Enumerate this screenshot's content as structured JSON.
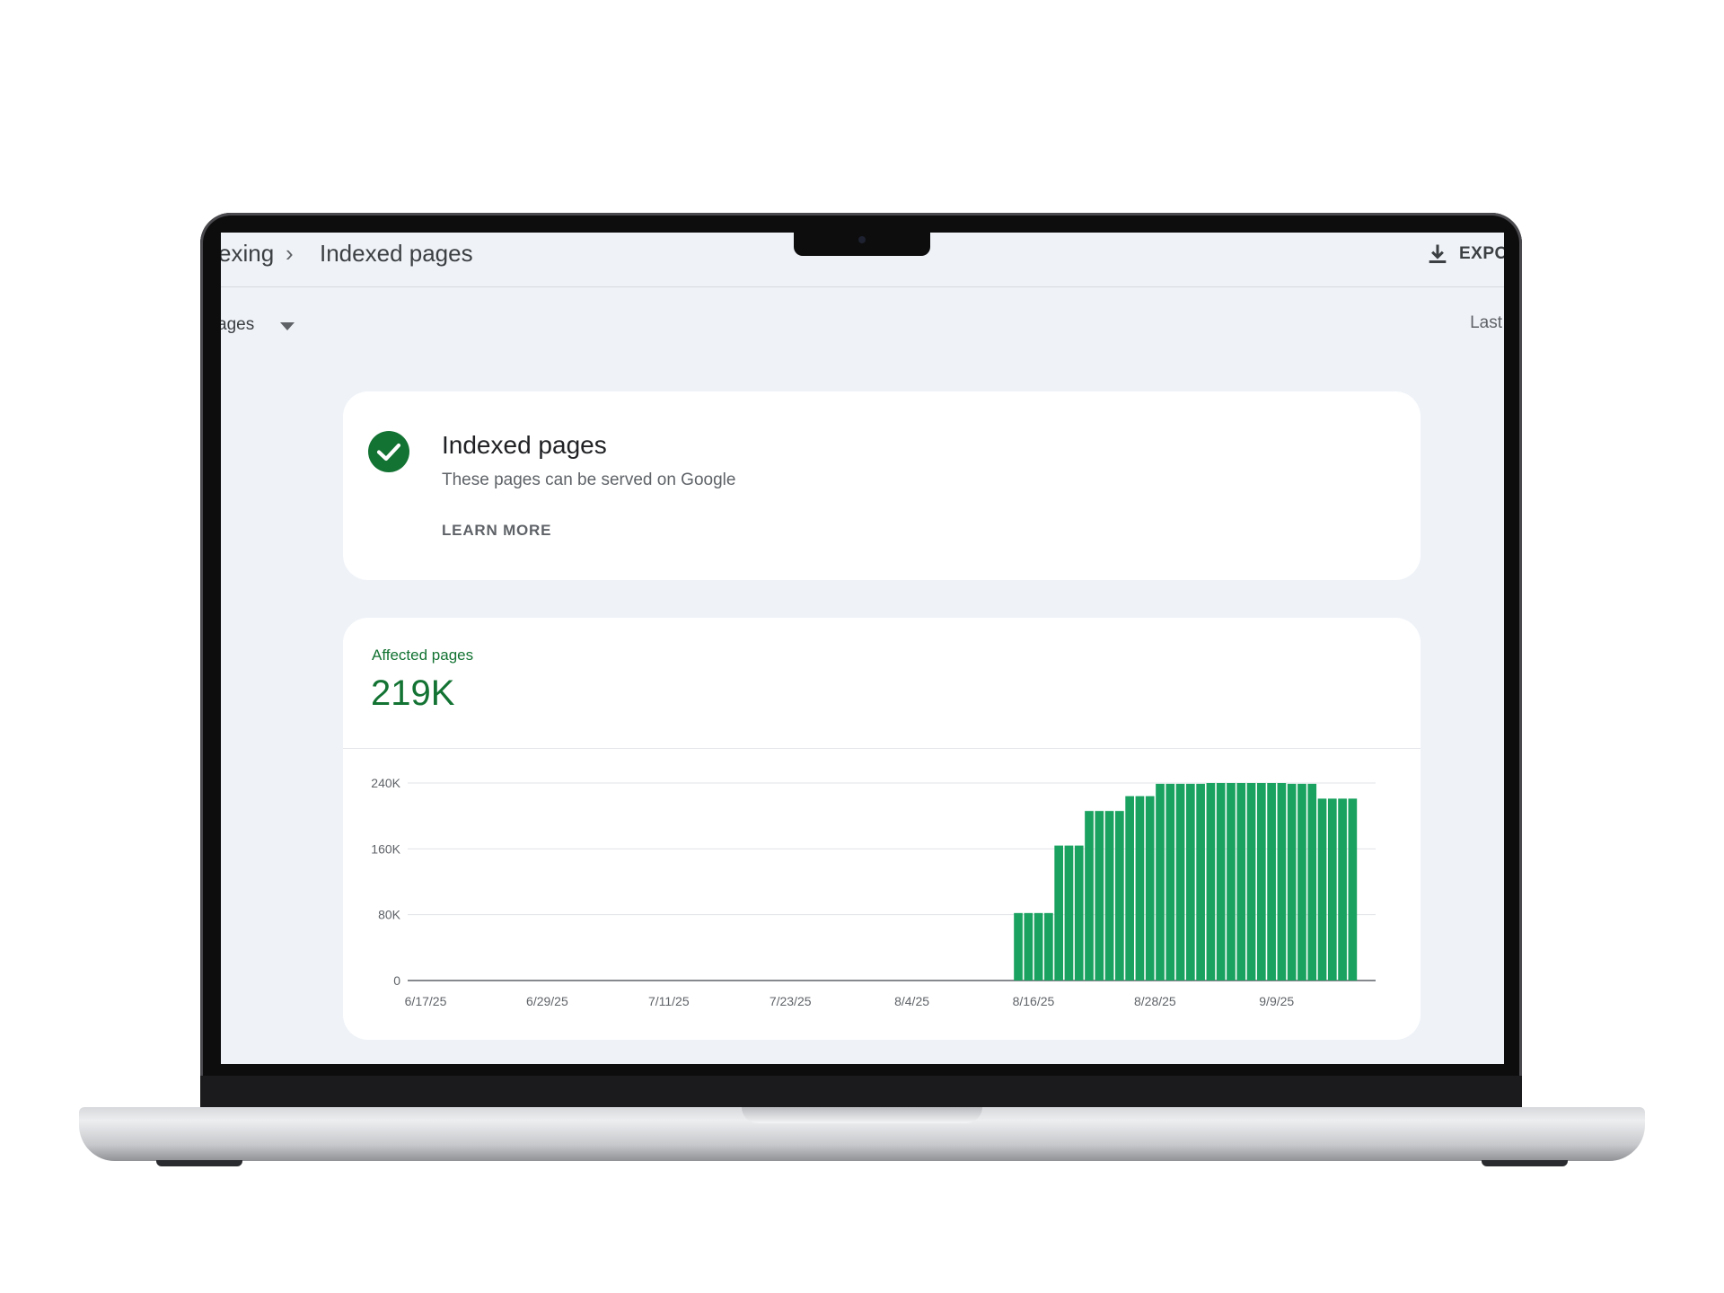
{
  "header": {
    "breadcrumb_prev": "exing",
    "breadcrumb_separator": "›",
    "breadcrumb_current": "Indexed pages",
    "export_label": "EXPO",
    "export_icon": "download-icon"
  },
  "filter": {
    "label": "ages",
    "icon": "dropdown-caret-icon"
  },
  "range": {
    "label": "Last"
  },
  "status_card": {
    "icon": "check-circle-icon",
    "title": "Indexed pages",
    "subtitle": "These pages can be served on Google",
    "link": "LEARN MORE"
  },
  "metric": {
    "label": "Affected pages",
    "value": "219K"
  },
  "colors": {
    "brand_green": "#137333",
    "bar_green": "#1aa260",
    "background": "#eff3f8"
  },
  "chart_data": {
    "type": "bar",
    "x_start": "6/17/25",
    "x_end": "9/17/25",
    "x_ticks": [
      "6/17/25",
      "6/29/25",
      "7/11/25",
      "7/23/25",
      "8/4/25",
      "8/16/25",
      "8/28/25",
      "9/9/25"
    ],
    "y_ticks": [
      "240K",
      "160K",
      "80K",
      "0"
    ],
    "ylim": [
      0,
      240000
    ],
    "bar_dates": [
      "8/14/25",
      "8/15/25",
      "8/16/25",
      "8/17/25",
      "8/18/25",
      "8/19/25",
      "8/20/25",
      "8/21/25",
      "8/22/25",
      "8/23/25",
      "8/24/25",
      "8/25/25",
      "8/26/25",
      "8/27/25",
      "8/28/25",
      "8/29/25",
      "8/30/25",
      "8/31/25",
      "9/1/25",
      "9/2/25",
      "9/3/25",
      "9/4/25",
      "9/5/25",
      "9/6/25",
      "9/7/25",
      "9/8/25",
      "9/9/25",
      "9/10/25",
      "9/11/25",
      "9/12/25",
      "9/13/25",
      "9/14/25",
      "9/15/25"
    ],
    "values": [
      82000,
      82000,
      82000,
      82000,
      164000,
      164000,
      164000,
      206000,
      206000,
      206000,
      206000,
      224000,
      224000,
      224000,
      239000,
      239000,
      239000,
      239000,
      239000,
      240000,
      240000,
      240000,
      240000,
      240000,
      240000,
      240000,
      240000,
      239000,
      239000,
      239000,
      221000,
      221000,
      221000,
      221000
    ],
    "grid": true,
    "legend": "none"
  }
}
